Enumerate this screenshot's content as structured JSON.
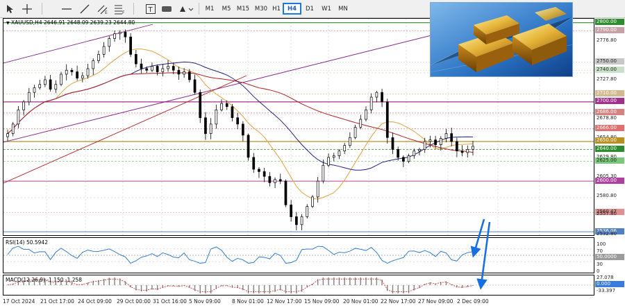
{
  "toolbar": {
    "timeframes": [
      "M1",
      "M5",
      "M15",
      "M30",
      "H1",
      "H4",
      "D1",
      "W1",
      "MN"
    ],
    "active_timeframe": "H4"
  },
  "chart": {
    "header": "XAUUSD,H4  2646.91  2648.09  2639.23  2644.80",
    "rsi_label": "RSI(14) 50.5942",
    "macd_label": "MACD(12,26,9) -1.150 -1.258"
  },
  "price_axis": {
    "labels": [
      "2800.00",
      "2790.00",
      "2776.80",
      "2750.00",
      "2740.00",
      "2727.80",
      "2710.00",
      "2700.00",
      "2686.00",
      "2678.80",
      "2666.00",
      "2654.80",
      "2650.00",
      "2640.00",
      "2629.80",
      "2625.00",
      "2605.30",
      "2600.00",
      "2580.80",
      "2560.47",
      "2557.80",
      "2536.06",
      "2532.80"
    ],
    "highlighted": [
      {
        "label": "2800.00",
        "color": "#2e8b2e"
      },
      {
        "label": "2790.00",
        "color": "#c8a0a8"
      },
      {
        "label": "2750.00",
        "color": "#c8c8c8"
      },
      {
        "label": "2740.00",
        "color": "#c8e0c8"
      },
      {
        "label": "2710.00",
        "color": "#d4b890"
      },
      {
        "label": "2700.00",
        "color": "#a0308c"
      },
      {
        "label": "2686.00",
        "color": "#d88080"
      },
      {
        "label": "2666.00",
        "color": "#e07070"
      },
      {
        "label": "2650.00",
        "color": "#b89020"
      },
      {
        "label": "2640.00",
        "color": "#2e8b2e"
      },
      {
        "label": "2625.00",
        "color": "#7ac87a"
      },
      {
        "label": "2600.00",
        "color": "#b040a0"
      },
      {
        "label": "2560.47",
        "color": "#e09090"
      },
      {
        "label": "2536.06",
        "color": "#5080c0"
      }
    ]
  },
  "rsi_axis": [
    "100",
    "70",
    "50.0000",
    "30",
    "0"
  ],
  "macd_axis": [
    "27.078",
    "0.000",
    "-33.397"
  ],
  "time_axis": [
    "17 Oct 2024",
    "21 Oct 17:00",
    "24 Oct 09:00",
    "29 Oct 00:00",
    "31 Oct 16:00",
    "5 Nov 09:00",
    "8 Nov 01:00",
    "12 Nov 17:00",
    "15 Nov 09:00",
    "20 Nov 01:00",
    "22 Nov 17:00",
    "27 Nov 09:00",
    "2 Dec 09:00"
  ],
  "colors": {
    "bull": "#ffffff",
    "bear": "#000000",
    "ma_orange": "#e0a040",
    "ma_navy": "#202080",
    "ma_red": "#b02020",
    "channel_purple": "#802080",
    "arrow_blue": "#1a6fe0"
  },
  "chart_data": {
    "type": "candlestick",
    "symbol": "XAUUSD",
    "timeframe": "H4",
    "ylim": [
      2530,
      2805
    ],
    "close_path": [
      2660,
      2672,
      2690,
      2700,
      2712,
      2718,
      2722,
      2728,
      2716,
      2722,
      2735,
      2740,
      2738,
      2730,
      2733,
      2742,
      2752,
      2760,
      2770,
      2780,
      2786,
      2788,
      2782,
      2760,
      2748,
      2742,
      2740,
      2745,
      2738,
      2742,
      2745,
      2740,
      2735,
      2738,
      2728,
      2712,
      2680,
      2660,
      2672,
      2690,
      2698,
      2694,
      2680,
      2672,
      2658,
      2630,
      2615,
      2612,
      2606,
      2598,
      2602,
      2600,
      2570,
      2555,
      2545,
      2555,
      2568,
      2580,
      2600,
      2620,
      2630,
      2632,
      2638,
      2645,
      2655,
      2668,
      2678,
      2690,
      2706,
      2712,
      2700,
      2655,
      2640,
      2630,
      2625,
      2632,
      2638,
      2640,
      2650,
      2652,
      2646,
      2654,
      2660,
      2650,
      2638,
      2636,
      2640,
      2644
    ],
    "highlighted_levels": [
      2800.0,
      2790.0,
      2750.0,
      2740.0,
      2710.0,
      2700.0,
      2686.0,
      2666.0,
      2650.0,
      2640.0,
      2625.0,
      2600.0,
      2560.47,
      2536.06
    ],
    "indicators": [
      "RSI(14)",
      "MACD(12,26,9)"
    ]
  }
}
